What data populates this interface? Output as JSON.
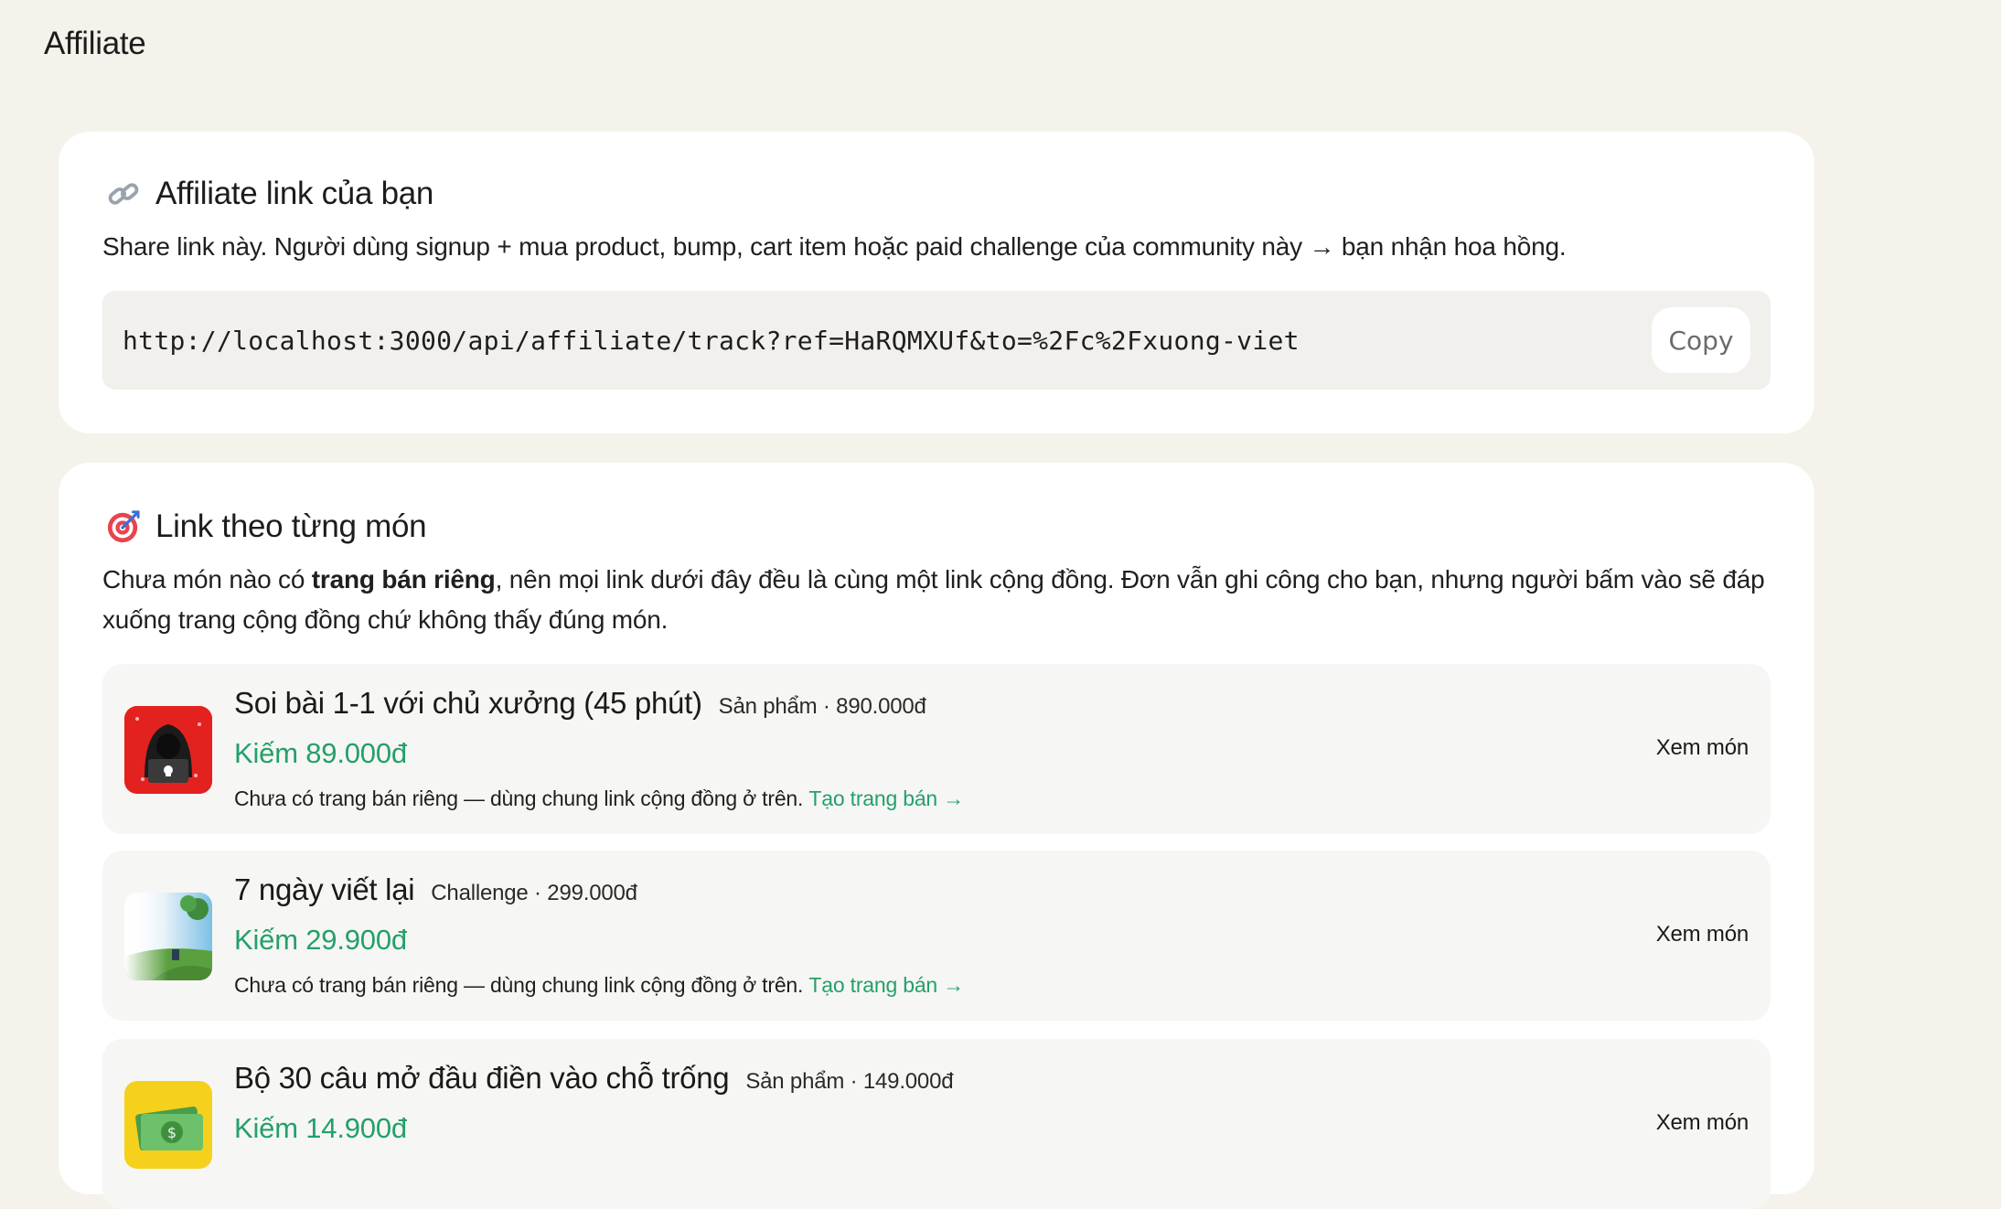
{
  "page": {
    "title": "Affiliate"
  },
  "affiliate_card": {
    "icon": "link-icon",
    "heading": "Affiliate link của bạn",
    "description": "Share link này. Người dùng signup + mua product, bump, cart item hoặc paid challenge của community này → bạn nhận hoa hồng.",
    "link": "http://localhost:3000/api/affiliate/track?ref=HaRQMXUf&to=%2Fc%2Fxuong-viet",
    "copy_label": "Copy"
  },
  "items_card": {
    "icon": "target-icon",
    "heading": "Link theo từng món",
    "description_prefix": "Chưa món nào có ",
    "description_bold": "trang bán riêng",
    "description_suffix": ", nên mọi link dưới đây đều là cùng một link cộng đồng. Đơn vẫn ghi công cho bạn, nhưng người bấm vào sẽ đáp xuống trang cộng đồng chứ không thấy đúng món.",
    "items": [
      {
        "title": "Soi bài 1-1 với chủ xưởng (45 phút)",
        "meta": "Sản phẩm · 890.000đ",
        "earn": "Kiếm 89.000đ",
        "note": "Chưa có trang bán riêng — dùng chung link cộng đồng ở trên.",
        "cta": "Tạo trang bán →",
        "view": "Xem món",
        "thumb_icon": "hacker-laptop-icon"
      },
      {
        "title": "7 ngày viết lại",
        "meta": "Challenge · 299.000đ",
        "earn": "Kiếm 29.900đ",
        "note": "Chưa có trang bán riêng — dùng chung link cộng đồng ở trên.",
        "cta": "Tạo trang bán →",
        "view": "Xem món",
        "thumb_icon": "landscape-icon"
      },
      {
        "title": "Bộ 30 câu mở đầu điền vào chỗ trống",
        "meta": "Sản phẩm · 149.000đ",
        "earn": "Kiếm 14.900đ",
        "note": "",
        "cta": "",
        "view": "Xem món",
        "thumb_icon": "money-icon"
      }
    ]
  },
  "colors": {
    "background": "#f4f2ea",
    "card": "#ffffff",
    "accent_green": "#24a06a"
  }
}
